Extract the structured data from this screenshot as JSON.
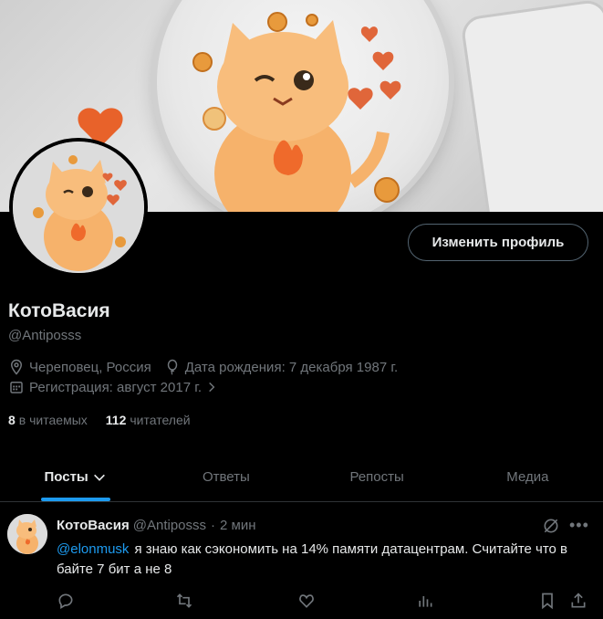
{
  "profile": {
    "name": "КотоВасия",
    "handle": "@Antiposss",
    "location": "Череповец, Россия",
    "birthday": "Дата рождения: 7 декабря 1987 г.",
    "joined": "Регистрация: август 2017 г.",
    "following_count": "8",
    "following_label": "в читаемых",
    "followers_count": "112",
    "followers_label": "читателей",
    "edit_button": "Изменить профиль"
  },
  "tabs": [
    {
      "label": "Посты",
      "active": true
    },
    {
      "label": "Ответы",
      "active": false
    },
    {
      "label": "Репосты",
      "active": false
    },
    {
      "label": "Медиа",
      "active": false
    }
  ],
  "post": {
    "author": "КотоВасия",
    "handle": "@Antiposss",
    "separator": "·",
    "time": "2 мин",
    "mention": "@elonmusk",
    "text": "я знаю как сэкономить на 14% памяти датацентрам. Считайте что в байте 7 бит а не 8"
  },
  "colors": {
    "accent": "#1d9bf0",
    "background": "#000000",
    "muted": "#71767b",
    "text": "#e7e9ea"
  },
  "icons": {
    "location": "location-pin-icon",
    "birthday": "balloon-icon",
    "joined": "calendar-icon",
    "joined_chevron": "chevron-right-icon",
    "tab_chevron": "chevron-down-icon",
    "reply": "reply-icon",
    "repost": "repost-icon",
    "like": "heart-icon",
    "views": "views-icon",
    "bookmark": "bookmark-icon",
    "share": "share-icon",
    "grok": "grok-icon",
    "more": "more-icon"
  }
}
